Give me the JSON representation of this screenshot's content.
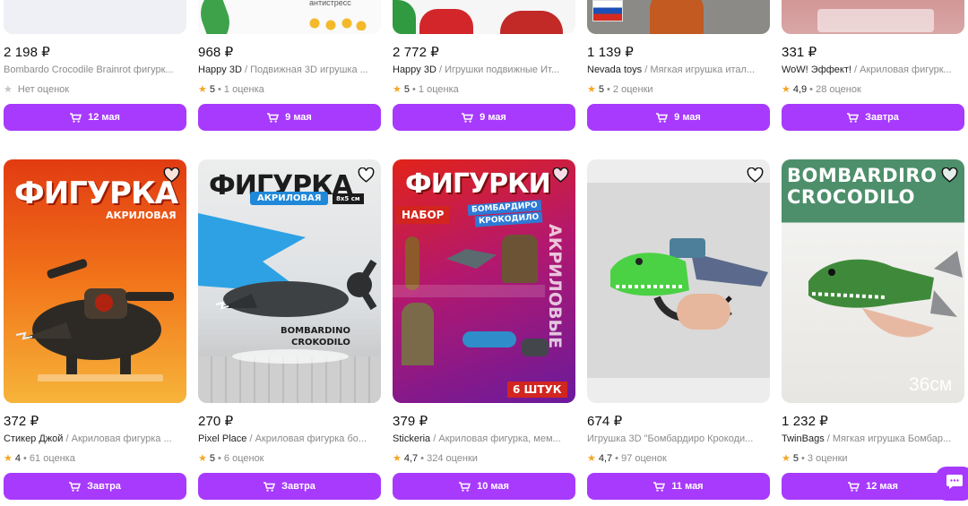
{
  "currency": "₽",
  "colors": {
    "accent": "#a73afd",
    "star": "#f6a623"
  },
  "top_row": [
    {
      "price": "2 198 ₽",
      "brand": "",
      "title": "Bombardo Crocodile Brainrot фигурк...",
      "star": "star-empty",
      "rating_score": "",
      "rating_text": "Нет оценок",
      "delivery": "12 мая",
      "image_text": ""
    },
    {
      "price": "968 ₽",
      "brand": "Happy 3D",
      "title": " / Подвижная 3D игрушка ...",
      "star": "star",
      "rating_score": "5",
      "rating_text": " • 1 оценка",
      "delivery": "9 мая",
      "image_text": "антистресс"
    },
    {
      "price": "2 772 ₽",
      "brand": "Happy 3D",
      "title": " / Игрушки подвижные Ит...",
      "star": "star",
      "rating_score": "5",
      "rating_text": " • 1 оценка",
      "delivery": "9 мая",
      "image_text": ""
    },
    {
      "price": "1 139 ₽",
      "brand": "Nevada toys",
      "title": " / Мягкая игрушка итал...",
      "star": "star",
      "rating_score": "5",
      "rating_text": " • 2 оценки",
      "delivery": "9 мая",
      "image_text": ""
    },
    {
      "price": "331 ₽",
      "brand": "WoW! Эффект!",
      "title": " / Акриловая фигурк...",
      "star": "star",
      "rating_score": "4,9",
      "rating_text": " • 28 оценок",
      "delivery": "Завтра",
      "image_text": ""
    }
  ],
  "bottom_row": [
    {
      "price": "372 ₽",
      "brand": "Стикер Джой",
      "title": " / Акриловая фигурка ...",
      "star": "star",
      "rating_score": "4",
      "rating_text": " • 61 оценка",
      "delivery": "Завтра",
      "image_text": {
        "line1": "ФИГУРКА",
        "line2": "АКРИЛОВАЯ"
      }
    },
    {
      "price": "270 ₽",
      "brand": "Pixel Place",
      "title": " / Акриловая фигурка бо...",
      "star": "star",
      "rating_score": "5",
      "rating_text": " • 6 оценок",
      "delivery": "Завтра",
      "image_text": {
        "line1": "ФИГУРКА",
        "line2": "АКРИЛОВАЯ",
        "line3": "8x5 см",
        "line4": "BOMBARDINO",
        "line5": "CROKODILO"
      }
    },
    {
      "price": "379 ₽",
      "brand": "Stickeria",
      "title": " / Акриловая фигурка, мем...",
      "star": "star",
      "rating_score": "4,7",
      "rating_text": " • 324 оценки",
      "delivery": "10 мая",
      "image_text": {
        "line1": "ФИГУРКИ",
        "line2": "НАБОР",
        "line3": "БОМБАРДИРО",
        "line4": "КРОКОДИЛО",
        "line5": "АКРИЛОВЫЕ",
        "line6": "6 ШТУК"
      }
    },
    {
      "price": "674 ₽",
      "brand": "",
      "title": "Игрушка 3D \"Бомбардиро Крокоди...",
      "star": "star",
      "rating_score": "4,7",
      "rating_text": " • 97 оценок",
      "delivery": "11 мая",
      "image_text": {}
    },
    {
      "price": "1 232 ₽",
      "brand": "TwinBags",
      "title": " / Мягкая игрушка Бомбар...",
      "star": "star",
      "rating_score": "5",
      "rating_text": " • 3 оценки",
      "delivery": "12 мая",
      "image_text": {
        "line1": "BOMBARDIRO",
        "line2": "CROCODILO",
        "line3": "36см"
      }
    }
  ],
  "icons": {
    "cart": "cart-icon",
    "heart": "heart-icon",
    "chat": "chat-icon"
  }
}
